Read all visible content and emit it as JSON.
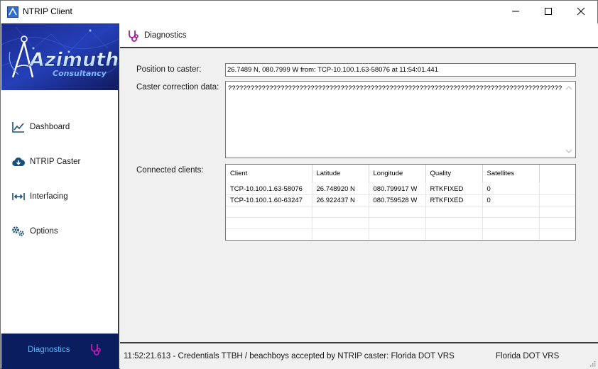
{
  "window": {
    "title": "NTRIP Client",
    "controls": [
      "minimize",
      "maximize",
      "close"
    ]
  },
  "sidebar": {
    "logo": {
      "brand": "Azimuth",
      "tagline": "Consultancy"
    },
    "items": [
      {
        "label": "Dashboard",
        "icon": "line-chart-icon"
      },
      {
        "label": "NTRIP Caster",
        "icon": "cloud-download-icon"
      },
      {
        "label": "Interfacing",
        "icon": "arrows-horizontal-icon"
      },
      {
        "label": "Options",
        "icon": "gears-icon"
      }
    ],
    "active": {
      "label": "Diagnostics",
      "icon": "stethoscope-icon"
    }
  },
  "main": {
    "header_title": "Diagnostics",
    "position_label": "Position to caster:",
    "position_value": "26.7489 N, 080.7999 W from: TCP-10.100.1.63-58076 at 11:54:01.441",
    "correction_label": "Caster correction data:",
    "correction_value": "??????????????????????????????????????????????????????????????????????????????????????????????????????????????",
    "clients_label": "Connected clients:",
    "clients": {
      "columns": [
        "Client",
        "Latitude",
        "Longitude",
        "Quality",
        "Satellites"
      ],
      "rows": [
        [
          "TCP-10.100.1.63-58076",
          "26.748920 N",
          "080.799917 W",
          "RTKFIXED",
          "0"
        ],
        [
          "TCP-10.100.1.60-63247",
          "26.922437 N",
          "080.759528 W",
          "RTKFIXED",
          "0"
        ]
      ]
    }
  },
  "status": {
    "message": "11:52:21.613 - Credentials TTBH / beachboys accepted by NTRIP caster: Florida DOT VRS",
    "caster": "Florida DOT VRS"
  },
  "colors": {
    "sidebar_active_bg": "#0a1d5e",
    "sidebar_active_text": "#5db8ff",
    "accent_icon": "#a8169a",
    "nav_icon": "#1a4f7a"
  }
}
